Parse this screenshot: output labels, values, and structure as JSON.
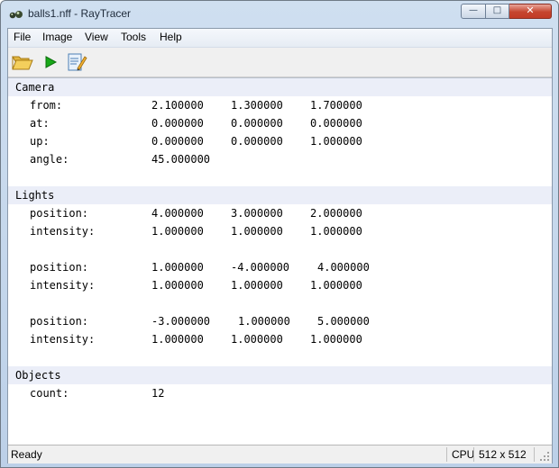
{
  "window": {
    "title": "balls1.nff - RayTracer",
    "controls": {
      "minimize": "—",
      "maximize": "□",
      "close": "✕"
    }
  },
  "menu": [
    {
      "label": "File"
    },
    {
      "label": "Image"
    },
    {
      "label": "View"
    },
    {
      "label": "Tools"
    },
    {
      "label": "Help"
    }
  ],
  "toolbar": {
    "buttons": [
      {
        "icon": "open-folder-icon"
      },
      {
        "icon": "play-icon"
      },
      {
        "icon": "edit-notes-icon"
      }
    ]
  },
  "scene": {
    "camera": {
      "header": "Camera",
      "rows": [
        {
          "label": "from:",
          "values": [
            "2.100000",
            "1.300000",
            "1.700000"
          ]
        },
        {
          "label": "at:",
          "values": [
            "0.000000",
            "0.000000",
            "0.000000"
          ]
        },
        {
          "label": "up:",
          "values": [
            "0.000000",
            "0.000000",
            "1.000000"
          ]
        },
        {
          "label": "angle:",
          "values": [
            "45.000000"
          ]
        }
      ]
    },
    "lights": {
      "header": "Lights",
      "groups": [
        {
          "position": {
            "label": "position:",
            "values": [
              "4.000000",
              "3.000000",
              "2.000000"
            ]
          },
          "intensity": {
            "label": "intensity:",
            "values": [
              "1.000000",
              "1.000000",
              "1.000000"
            ]
          }
        },
        {
          "position": {
            "label": "position:",
            "values": [
              "1.000000",
              "-4.000000",
              "4.000000"
            ]
          },
          "intensity": {
            "label": "intensity:",
            "values": [
              "1.000000",
              "1.000000",
              "1.000000"
            ]
          }
        },
        {
          "position": {
            "label": "position:",
            "values": [
              "-3.000000",
              "1.000000",
              "5.000000"
            ]
          },
          "intensity": {
            "label": "intensity:",
            "values": [
              "1.000000",
              "1.000000",
              "1.000000"
            ]
          }
        }
      ]
    },
    "objects": {
      "header": "Objects",
      "rows": [
        {
          "label": "count:",
          "values": [
            "12"
          ]
        }
      ]
    }
  },
  "status": {
    "text": "Ready",
    "mode": "CPU",
    "resolution": "512 x 512"
  },
  "colors": {
    "section_header_bg": "#ebeef8",
    "close_button": "#c6452f",
    "play_green": "#18a818"
  }
}
